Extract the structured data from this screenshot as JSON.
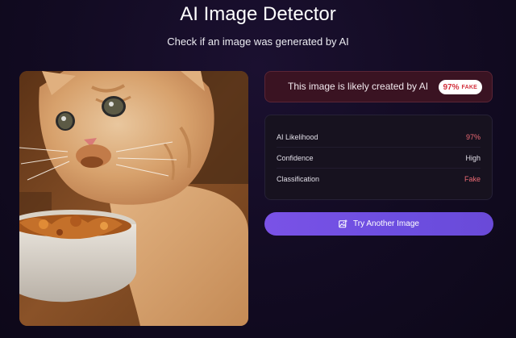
{
  "header": {
    "title": "AI Image Detector",
    "subtitle": "Check if an image was generated by AI"
  },
  "preview": {
    "icon": "uploaded-image"
  },
  "result": {
    "message": "This image is likely created by AI",
    "badge_percent": "97%",
    "badge_label": "FAKE",
    "accent_color": "#d2303c"
  },
  "stats": [
    {
      "label": "AI Likelihood",
      "value": "97%"
    },
    {
      "label": "Confidence",
      "value": "High"
    },
    {
      "label": "Classification",
      "value": "Fake"
    }
  ],
  "actions": {
    "try_another_label": "Try Another Image",
    "button_color": "#7a52e6"
  }
}
